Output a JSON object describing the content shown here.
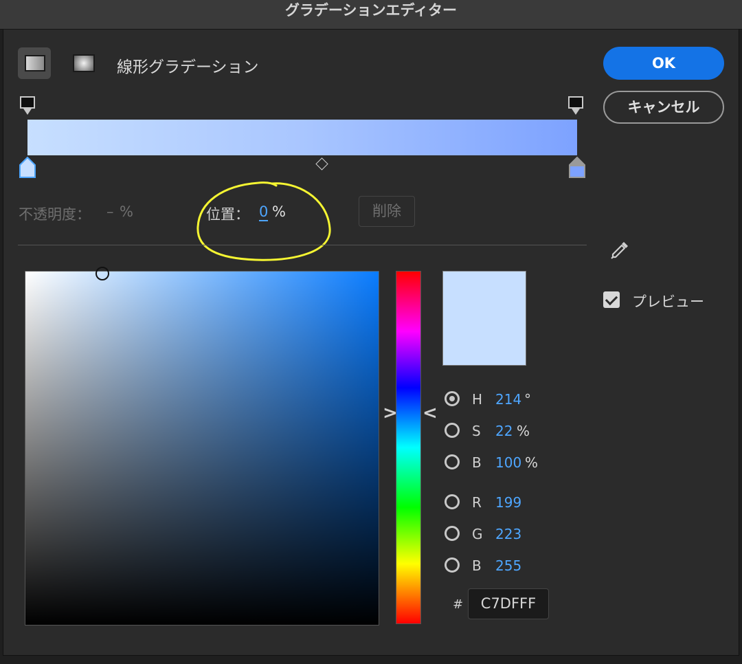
{
  "window": {
    "title": "グラデーションエディター"
  },
  "gradient": {
    "type_label": "線形グラデーション",
    "stop_colors": [
      "#c7dfff",
      "#7da2ff"
    ],
    "opacity_label": "不透明度：",
    "opacity_value": "–",
    "opacity_unit": "%",
    "location_label": "位置：",
    "location_value": "0",
    "location_unit": "%",
    "delete_label": "削除"
  },
  "picker": {
    "current_color": "#c7dfff",
    "channels": {
      "h": {
        "label": "H",
        "value": "214",
        "unit": "°",
        "selected": true
      },
      "s": {
        "label": "S",
        "value": "22",
        "unit": "%"
      },
      "b": {
        "label": "B",
        "value": "100",
        "unit": "%"
      },
      "r": {
        "label": "R",
        "value": "199"
      },
      "g": {
        "label": "G",
        "value": "223"
      },
      "b2": {
        "label": "B",
        "value": "255"
      }
    },
    "hex_label": "#",
    "hex_value": "C7DFFF"
  },
  "actions": {
    "ok_label": "OK",
    "cancel_label": "キャンセル",
    "preview_label": "プレビュー",
    "preview_checked": true
  },
  "annotation": {
    "color": "#f5f532"
  }
}
